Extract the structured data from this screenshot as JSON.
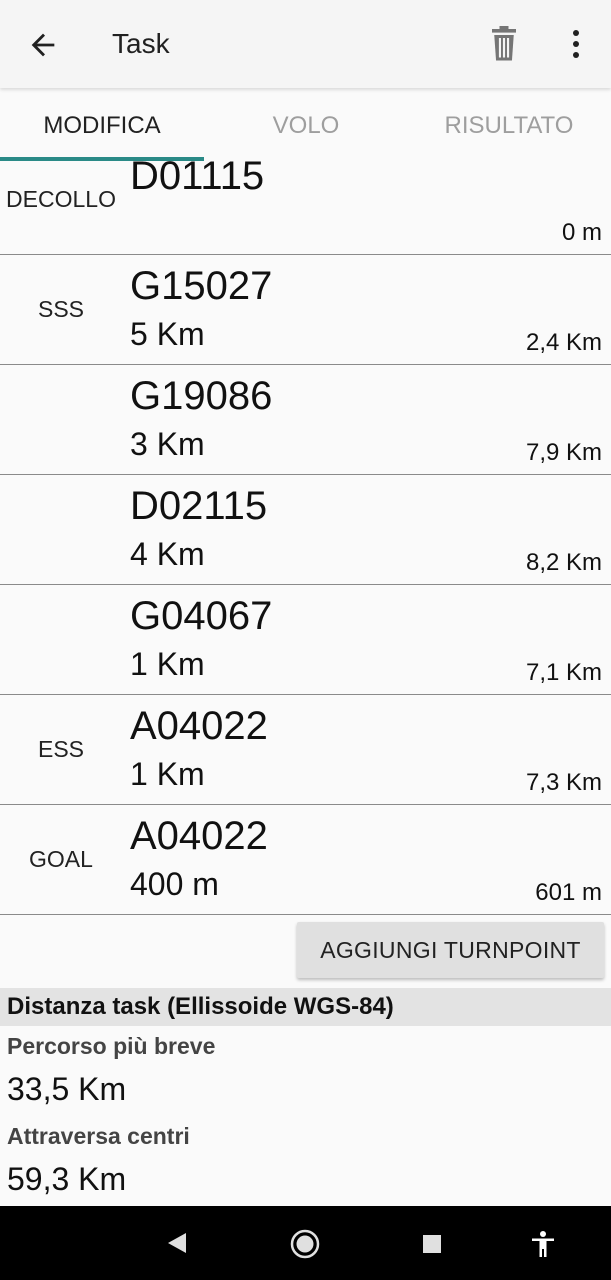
{
  "appbar": {
    "title": "Task",
    "back_icon": "arrow-left-icon",
    "delete_icon": "trash-icon",
    "menu_icon": "more-vertical-icon"
  },
  "tabs": [
    {
      "label": "MODIFICA",
      "active": true
    },
    {
      "label": "VOLO",
      "active": false
    },
    {
      "label": "RISULTATO",
      "active": false
    }
  ],
  "turnpoints": [
    {
      "type": "DECOLLO",
      "code": "D01115",
      "radius": "",
      "distance": "0 m"
    },
    {
      "type": "SSS",
      "code": "G15027",
      "radius": "5 Km",
      "distance": "2,4 Km"
    },
    {
      "type": "",
      "code": "G19086",
      "radius": "3 Km",
      "distance": "7,9 Km"
    },
    {
      "type": "",
      "code": "D02115",
      "radius": "4 Km",
      "distance": "8,2 Km"
    },
    {
      "type": "",
      "code": "G04067",
      "radius": "1 Km",
      "distance": "7,1 Km"
    },
    {
      "type": "ESS",
      "code": "A04022",
      "radius": "1 Km",
      "distance": "7,3 Km"
    },
    {
      "type": "GOAL",
      "code": "A04022",
      "radius": "400 m",
      "distance": "601 m"
    }
  ],
  "add_button": "AGGIUNGI TURNPOINT",
  "summary": {
    "heading": "Distanza task (Ellissoide WGS-84)",
    "shortest_label": "Percorso più breve",
    "shortest_value": "33,5 Km",
    "centers_label": "Attraversa centri",
    "centers_value": "59,3 Km"
  },
  "navbar": {
    "back_icon": "nav-back-icon",
    "home_icon": "nav-home-icon",
    "recents_icon": "nav-recents-icon",
    "accessibility_icon": "accessibility-icon"
  }
}
